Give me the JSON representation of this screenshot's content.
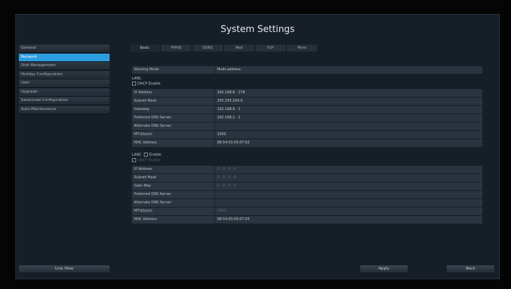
{
  "title": "System Settings",
  "sidebar": {
    "items": [
      {
        "label": "General"
      },
      {
        "label": "Network"
      },
      {
        "label": "Disk Management"
      },
      {
        "label": "Holiday Configuration"
      },
      {
        "label": "User"
      },
      {
        "label": "Upgrade"
      },
      {
        "label": "Save/Load Configuration"
      },
      {
        "label": "Auto-Maintenance"
      }
    ],
    "active_index": 1,
    "live_view_label": "Live View"
  },
  "tabs": [
    {
      "label": "Basic"
    },
    {
      "label": "PPPoE"
    },
    {
      "label": "DDNS"
    },
    {
      "label": "Mail"
    },
    {
      "label": "P2P"
    },
    {
      "label": "More"
    }
  ],
  "working_mode": {
    "label": "Working Mode",
    "value": "Multi-address"
  },
  "lan1": {
    "title": "LAN1",
    "dhcp_label": "DHCP Enable",
    "fields": [
      {
        "label": "IP Address",
        "value": "192.168.8 . 178"
      },
      {
        "label": "Subnet Mask",
        "value": "255.255.254.0"
      },
      {
        "label": "Gateway",
        "value": "192.168.8 . 1"
      },
      {
        "label": "Preferred DNS Server",
        "value": "192.168.1 . 1"
      },
      {
        "label": "Alternate DNS Server",
        "value": ""
      },
      {
        "label": "MTU(byte)",
        "value": "1500"
      },
      {
        "label": "MAC Address",
        "value": "08:54:03:05:07:02"
      }
    ]
  },
  "lan2": {
    "title": "LAN2",
    "enable_label": "Enable",
    "dhcp_label": "DHCP Enable",
    "fields": [
      {
        "label": "IP Address",
        "value": "0 . 0 . 0 . 0"
      },
      {
        "label": "Subnet Mask",
        "value": "0 . 0 . 0 . 0"
      },
      {
        "label": "Gate Way",
        "value": "0 . 0 . 0 . 0"
      },
      {
        "label": "Preferred DNS Server",
        "value": ""
      },
      {
        "label": "Alternate DNS Server",
        "value": ""
      },
      {
        "label": "MTU(byte)",
        "value": "1500"
      },
      {
        "label": "MAC Address",
        "value": "08:54:03:05:07:03"
      }
    ]
  },
  "buttons": {
    "apply": "Apply",
    "back": "Back"
  }
}
